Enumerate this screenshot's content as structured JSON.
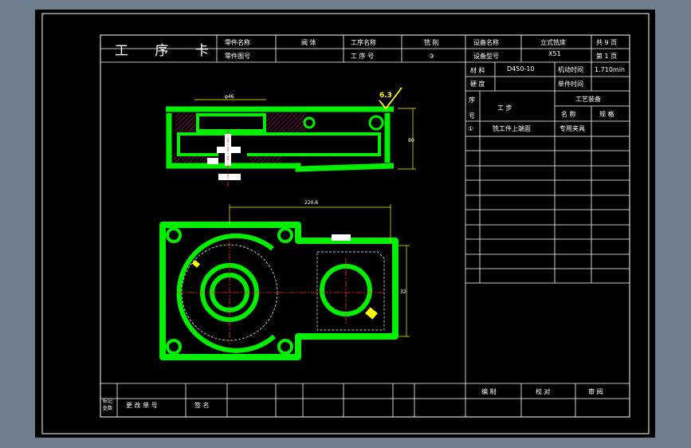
{
  "colors": {
    "background": "#6f7e8d",
    "paper": "#000000",
    "frame": "#ffffff",
    "part": "#00ee00",
    "dimension": "#ffff00",
    "centerline": "#ff2a2a",
    "hidden_line": "#ffffff"
  },
  "header": {
    "title": "工 序 卡",
    "part_name_label": "零件名称",
    "part_name_value": "阀 体",
    "part_no_label": "零件图号",
    "part_no_value": "",
    "process_name_label": "工序名称",
    "process_name_value": "铣 削",
    "process_no_label": "工 序 号",
    "process_no_value": "③",
    "equip_name_label": "设备名称",
    "equip_name_value": "立式铣床",
    "equip_model_label": "设备型号",
    "equip_model_value": "X51",
    "total_pages_label": "共 9 页",
    "page_label": "第 1 页"
  },
  "side_table": {
    "material_label": "材 料",
    "material_value": "D450-10",
    "machine_time_label": "机动时间",
    "machine_time_value": "1.710min",
    "hardness_label": "硬 度",
    "hardness_value": "",
    "unit_time_label": "单件时间",
    "unit_time_value": "",
    "seq_label_top": "序",
    "seq_label_bottom": "号",
    "step_label": "工 步",
    "equipment_label": "工艺装备",
    "name_label": "名 称",
    "spec_label": "规 格",
    "rows": [
      {
        "seq": "①",
        "step": "铣工件上端面",
        "name": "专用夹具",
        "spec": ""
      }
    ]
  },
  "footer": {
    "mark_label": "标记",
    "count_label": "处数",
    "change_no_label": "更 改 单 号",
    "sign_label": "签 名",
    "compile_label": "编 制",
    "check_label": "校 对",
    "review_label": "审 阅"
  },
  "drawing": {
    "surface_finish": "6.3",
    "dim_top_width": "φ46",
    "dim_height": "80",
    "dim_length": "220.6",
    "dim_right_height": "32"
  }
}
